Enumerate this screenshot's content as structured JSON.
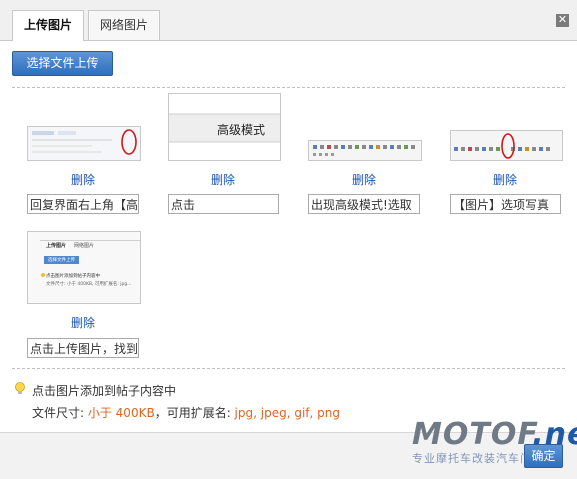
{
  "tabs": [
    {
      "label": "上传图片",
      "active": true
    },
    {
      "label": "网络图片",
      "active": false
    }
  ],
  "upload_button": "选择文件上传",
  "delete_label": "删除",
  "thumb2_text": "高级模式",
  "thumb5_text": {
    "tab1": "上传图片",
    "tab2": "网络图片",
    "btn": "选择文件上传",
    "line1": "点击图片添加到帖子内容中",
    "line2": "文件尺寸: 小于 400KB, 可用扩展名: jpg..."
  },
  "images": [
    {
      "caption": "回复界面右上角【高"
    },
    {
      "caption": "点击"
    },
    {
      "caption": "出现高级模式!选取"
    },
    {
      "caption": "【图片】选项写真"
    },
    {
      "caption": "点击上传图片，找到"
    }
  ],
  "info": {
    "line1": "点击图片添加到帖子内容中",
    "size_label": "文件尺寸: ",
    "size_value": "小于 400KB",
    "ext_label": "，可用扩展名: ",
    "ext_value": "jpg, jpeg, gif, png"
  },
  "ok_button": "确定",
  "watermark": {
    "big_a": "MOTOF",
    "big_b": ".net",
    "small": "专业摩托车改装汽车门户网"
  }
}
